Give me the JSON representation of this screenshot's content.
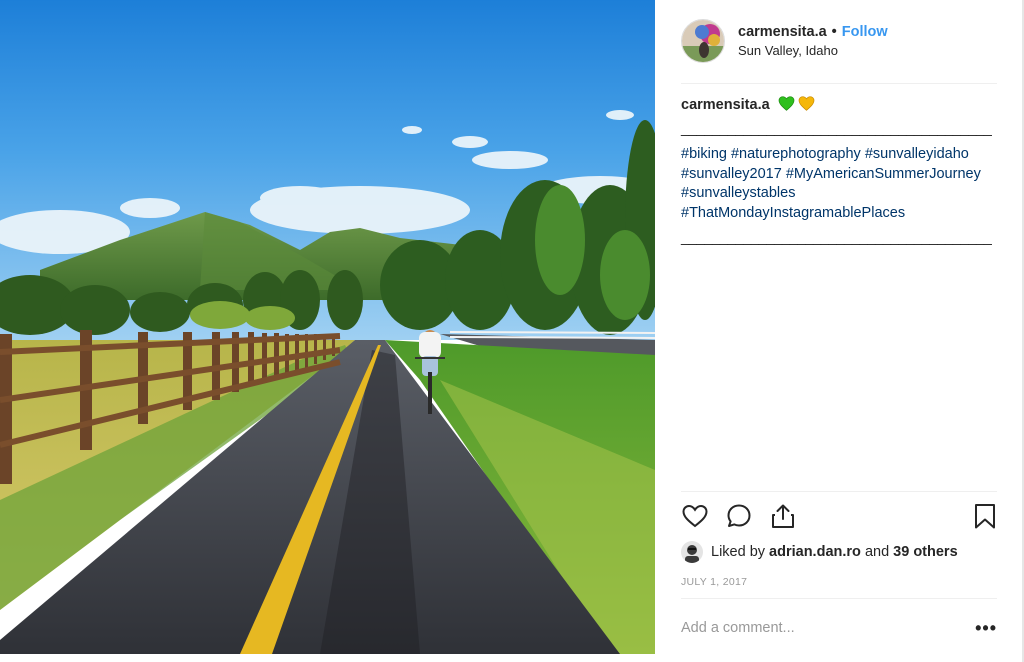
{
  "post": {
    "username": "carmensita.a",
    "separator": "•",
    "follow_label": "Follow",
    "location": "Sun Valley, Idaho"
  },
  "caption": {
    "username": "carmensita.a",
    "hearts": [
      "green-heart-icon",
      "yellow-heart-icon"
    ],
    "separator_line": "________________________________________",
    "hashtags": [
      "#biking",
      "#naturephotography",
      "#sunvalleyidaho",
      "#sunvalley2017",
      "#MyAmericanSummerJourney",
      "#sunvalleystables",
      "#ThatMondayInstagramablePlaces"
    ]
  },
  "actions": {
    "icons": [
      "heart-icon",
      "comment-icon",
      "share-icon",
      "bookmark-icon"
    ]
  },
  "likes": {
    "prefix": "Liked by",
    "user": "adrian.dan.ro",
    "middle": "and",
    "others": "39 others"
  },
  "date": "July 1, 2017",
  "comment": {
    "placeholder": "Add a comment...",
    "more_label": "•••"
  },
  "colors": {
    "link": "#3897f0",
    "hashtag": "#003569",
    "muted": "#999999",
    "green_heart": "#2fbf1e",
    "yellow_heart": "#f5b70a"
  }
}
